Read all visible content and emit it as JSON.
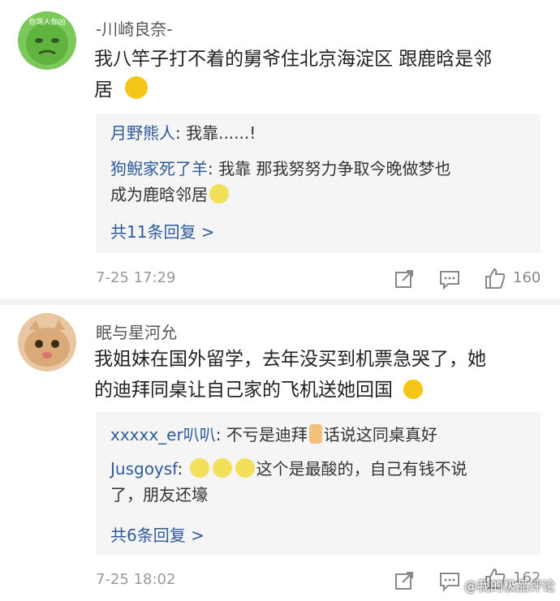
{
  "comments": [
    {
      "username": "-川崎良奈-",
      "avatar_caption": "你骂人你凶",
      "content_l1": "我八竿子打不着的舅爷住北京海淀区 跟鹿晗是邻",
      "content_l2": "居",
      "replies": [
        {
          "user": "月野熊人",
          "text_l1": ": 我靠......!"
        },
        {
          "user": "狗鲵家死了羊",
          "text_l1": ": 我靠 那我努努力争取今晚做梦也",
          "text_l2": "成为鹿晗邻居"
        }
      ],
      "more_replies": "共11条回复 >",
      "time": "7-25 17:29",
      "likes": "160"
    },
    {
      "username": "眠与星河允",
      "content_l1": "我姐妹在国外留学，去年没买到机票急哭了，她",
      "content_l2": "的迪拜同桌让自己家的飞机送她回国",
      "replies": [
        {
          "user": "xxxxx_er叭叭",
          "text_l1": ": 不亏是迪拜",
          "text_l1b": "话说这同桌真好"
        },
        {
          "user": "Jusgoysf",
          "text_l1": "这个是最酸的，自己有钱不说",
          "text_l2": "了，朋友还壕"
        }
      ],
      "more_replies": "共6条回复 >",
      "time": "7-25 18:02",
      "likes": "162"
    }
  ],
  "icons": [
    "share-icon",
    "comment-icon",
    "thumbs-up-icon",
    "lemon-emoji-icon",
    "smirk-emoji-icon"
  ],
  "watermark": "@我的极品评论",
  "colors": {
    "link": "#2f5a99",
    "reply_bg": "#f5f5f5",
    "meta": "#999999"
  }
}
